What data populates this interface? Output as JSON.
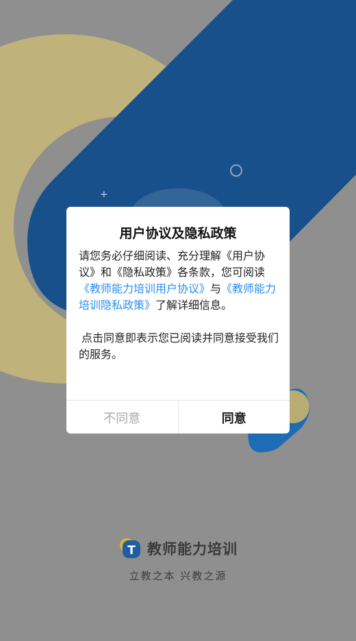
{
  "dialog": {
    "title": "用户协议及隐私政策",
    "body_intro": "请您务必仔细阅读、充分理解《用户协议》和《隐私政策》各条款，您可阅读",
    "user_agreement_link": "《教师能力培训用户协议》",
    "connector": "与",
    "privacy_link": "《教师能力培训隐私政策》",
    "body_end": "了解详细信息。",
    "consent_text": "点击同意即表示您已阅读并同意接受我们的服务。",
    "disagree_label": "不同意",
    "agree_label": "同意"
  },
  "brand": {
    "logo_letter": "T",
    "name": "教师能力培训",
    "slogan": "立教之本  兴教之源"
  },
  "colors": {
    "background": "#8f8f8f",
    "blue_shape": "#17508a",
    "yellow_shape": "#bfb27a",
    "link": "#2a8ff0",
    "logo_blue": "#1d5fa0",
    "logo_yellow": "#d9b43a"
  }
}
